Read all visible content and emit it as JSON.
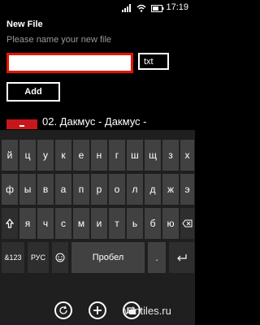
{
  "status_bar": {
    "time": "17:19",
    "icons": [
      "signal-icon",
      "wifi-icon",
      "battery-icon"
    ]
  },
  "header": {
    "title": "New File",
    "subtitle": "Please name your new file"
  },
  "form": {
    "name_value": "",
    "extension": "txt",
    "add_label": "Add"
  },
  "file_list": {
    "items": [
      {
        "name": "02. Дакмус - Дакмус -"
      }
    ]
  },
  "keyboard": {
    "row1": [
      "й",
      "ц",
      "у",
      "к",
      "е",
      "н",
      "г",
      "ш",
      "щ",
      "з",
      "х"
    ],
    "row2": [
      "ф",
      "ы",
      "в",
      "а",
      "п",
      "р",
      "о",
      "л",
      "д",
      "ж",
      "э"
    ],
    "row3": [
      "я",
      "ч",
      "с",
      "м",
      "и",
      "т",
      "ь",
      "б",
      "ю"
    ],
    "row4": {
      "numbers": "&123",
      "language": "РУС",
      "space": "Пробел",
      "period": "."
    }
  },
  "app_bar": {
    "buttons": [
      "refresh-icon",
      "add-icon",
      "open-folder-icon"
    ]
  },
  "watermark": "wintiles.ru",
  "colors": {
    "accent": "#e51400",
    "background": "#000000",
    "key": "#414141",
    "key_dark": "#2e2e2e",
    "keyboard_bg": "#1f1f1f"
  }
}
